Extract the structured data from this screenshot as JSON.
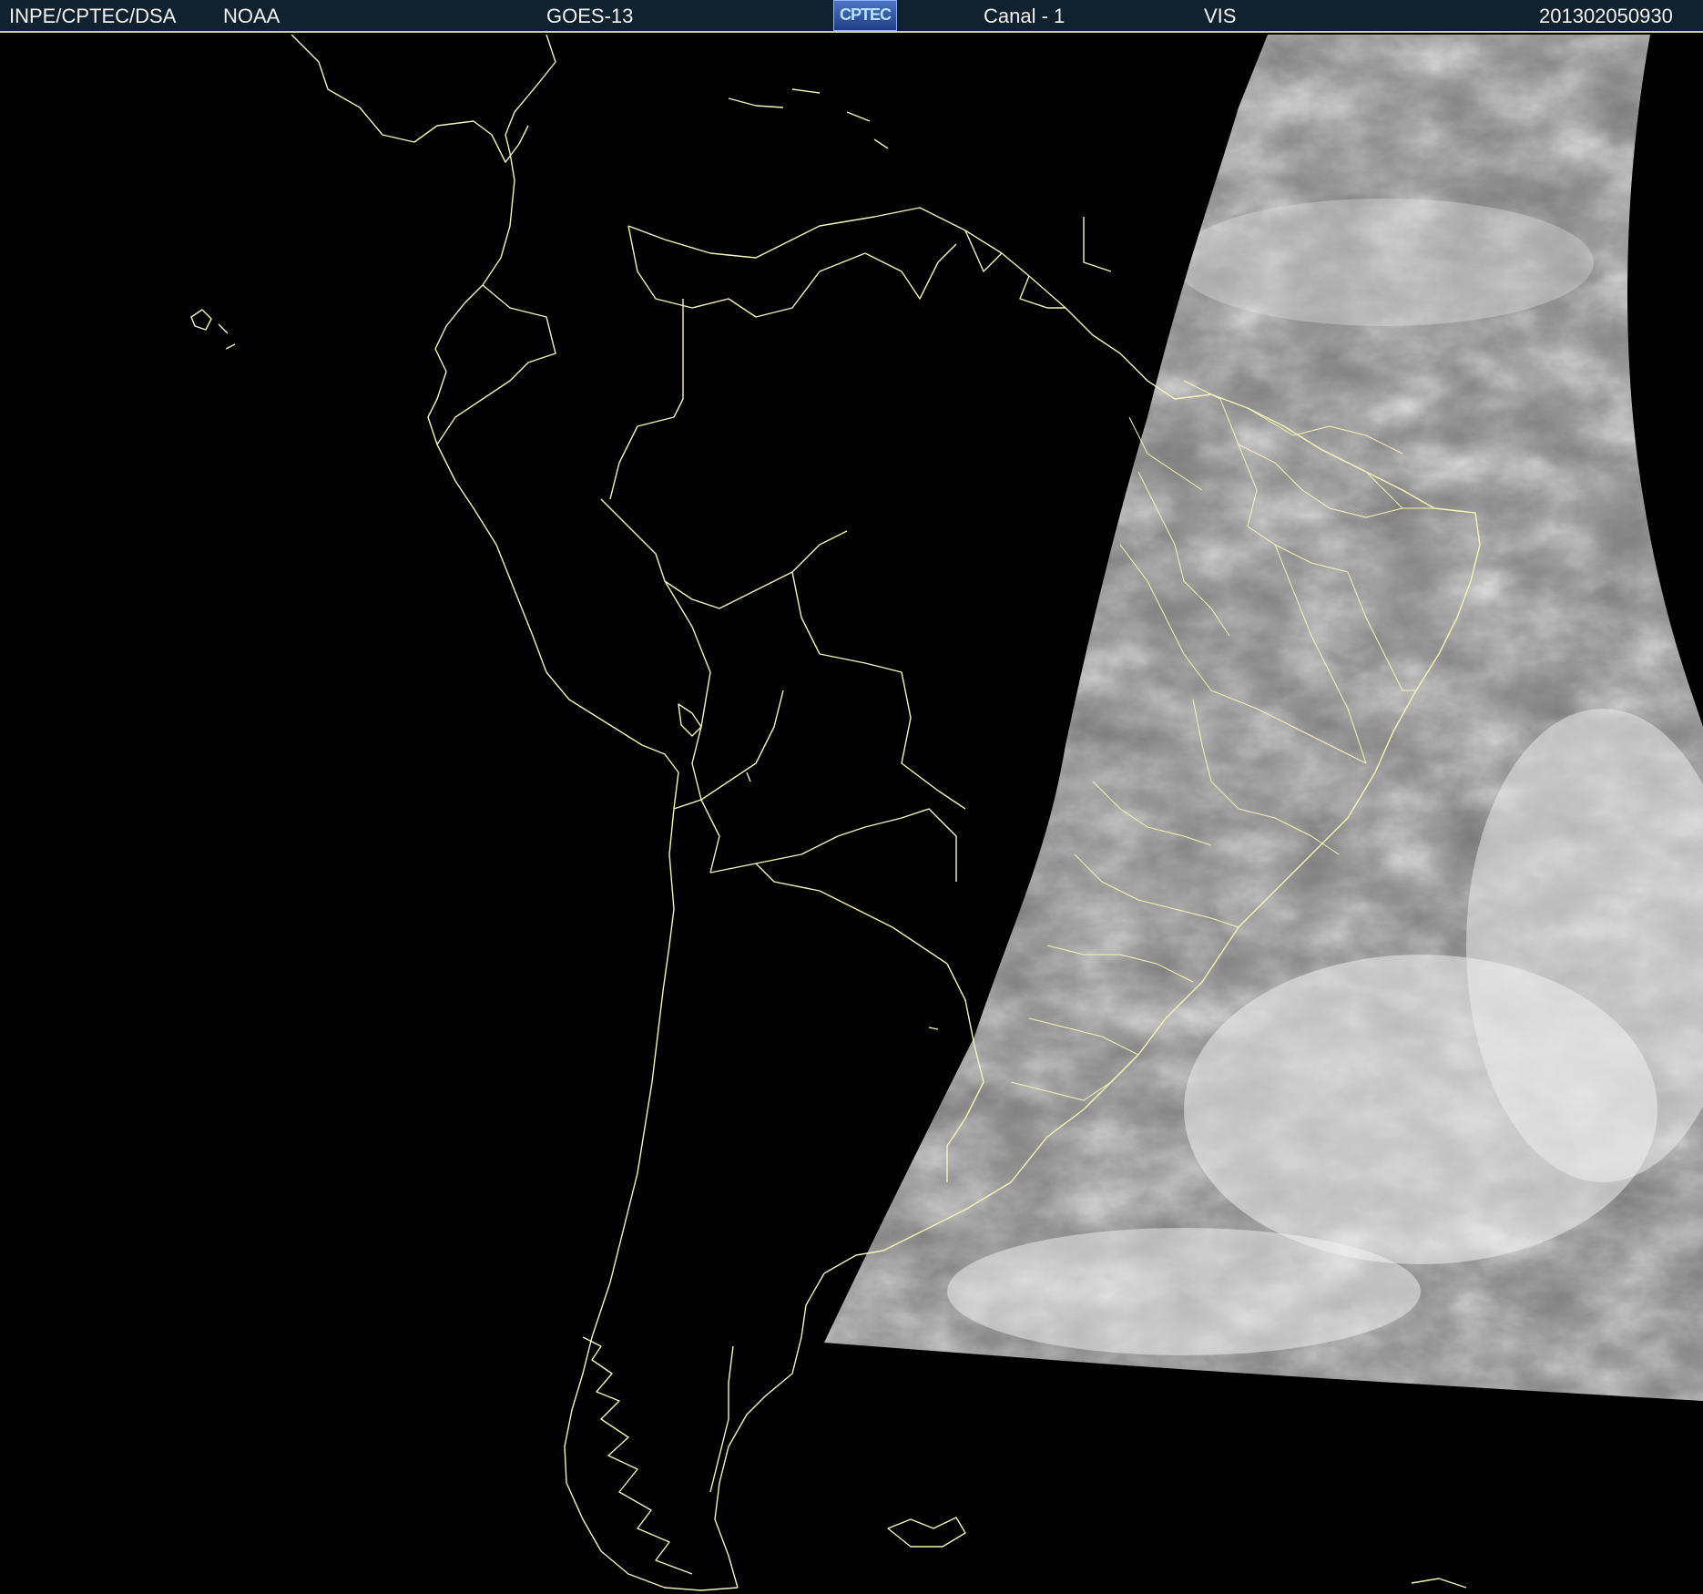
{
  "header": {
    "agency": "INPE/CPTEC/DSA",
    "source": "NOAA",
    "satellite": "GOES-13",
    "logo_text": "CPTEC",
    "channel": "Canal - 1",
    "band": "VIS",
    "timestamp": "201302050930"
  },
  "colors": {
    "header_background": "#10212f",
    "border_lines": "#f5f5b4",
    "background": "#000000",
    "cloud_bright": "#f2f2f2",
    "surface_gray": "#7a7a7a"
  },
  "map": {
    "region": "South America",
    "imagery": "visible satellite image with country and state boundaries"
  }
}
